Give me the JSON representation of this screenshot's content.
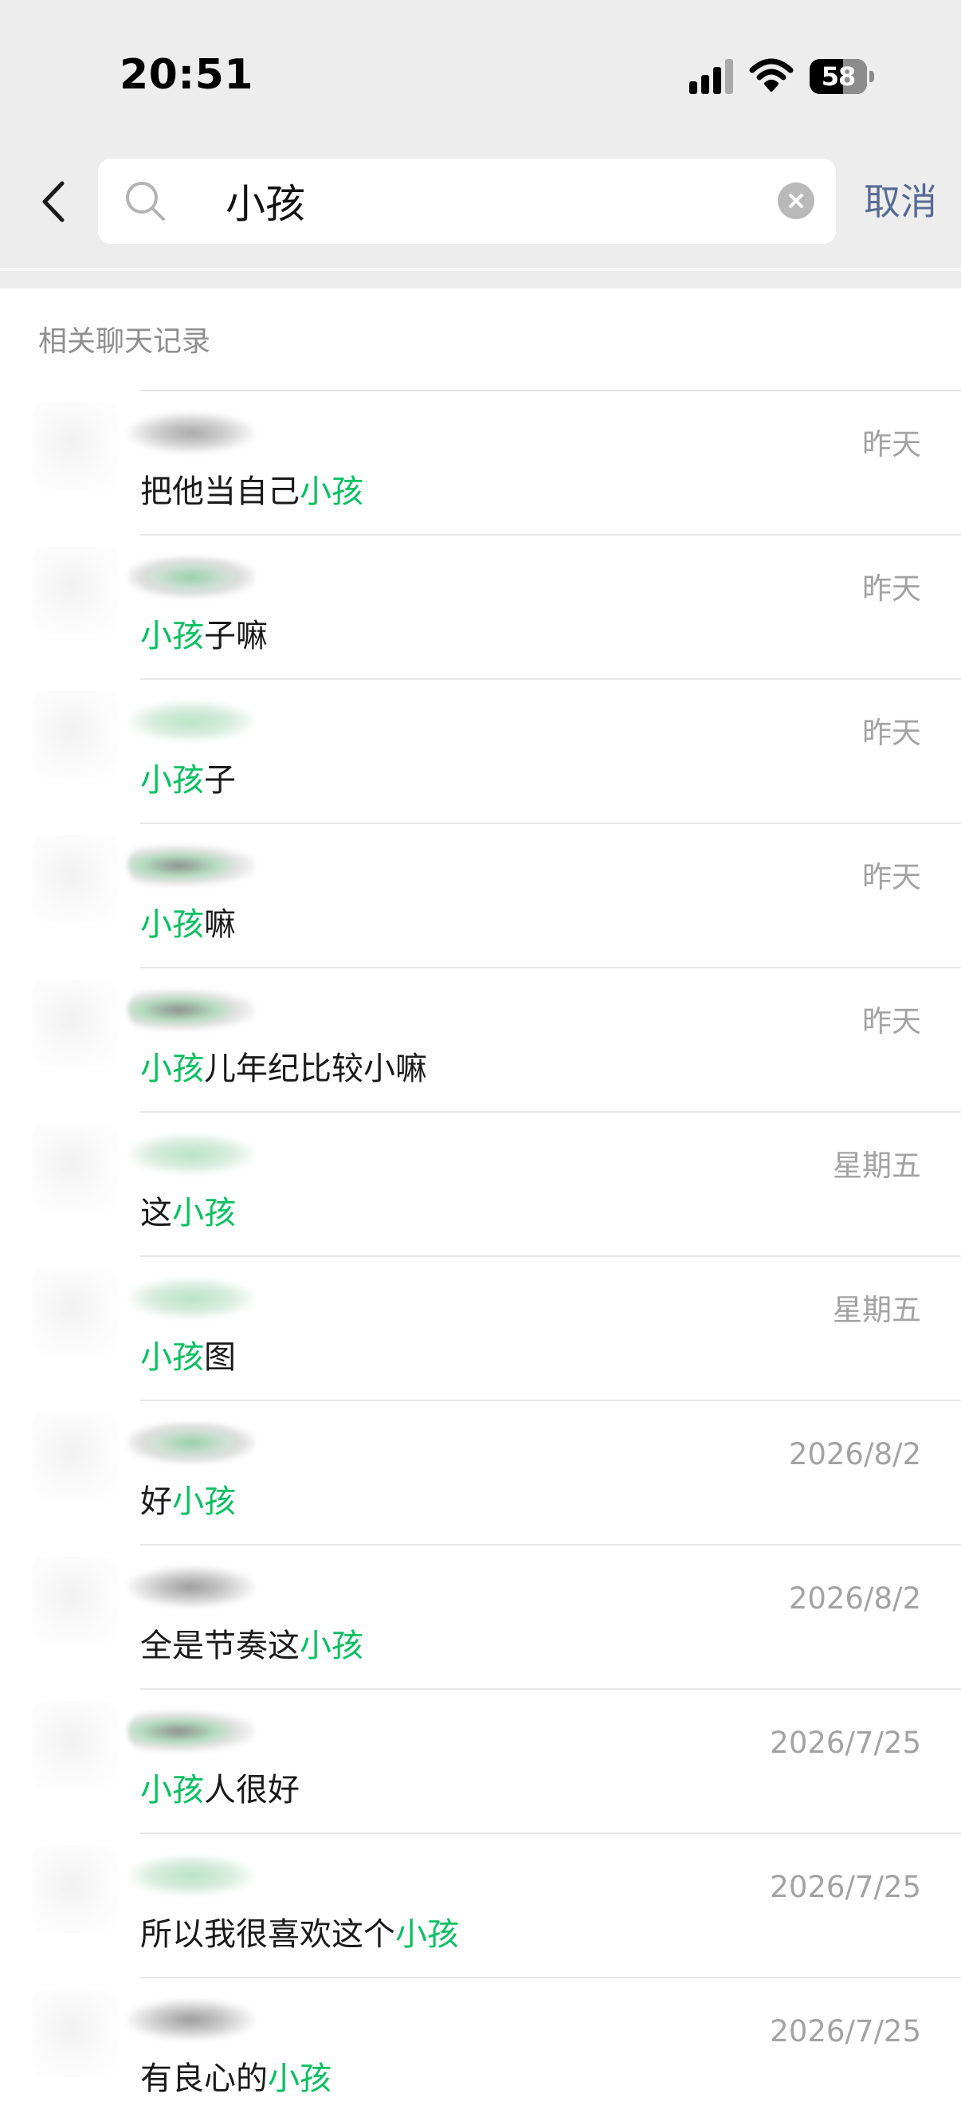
{
  "status_bar": {
    "time": "20:51",
    "battery_level": "58",
    "battery_fraction": 0.58,
    "signal_bars_filled": 3,
    "signal_bars_total": 4
  },
  "search": {
    "query": "小孩",
    "cancel_label": "取消",
    "clear_icon": "clear-icon",
    "search_icon": "search-icon",
    "back_icon": "back-chevron-icon"
  },
  "section": {
    "title": "相关聊天记录"
  },
  "colors": {
    "highlight": "#07c160",
    "link": "#576b95",
    "background_grey": "#ededed"
  },
  "results": [
    {
      "date": "昨天",
      "pre": "把他当自己",
      "hit": "小孩",
      "post": ""
    },
    {
      "date": "昨天",
      "pre": "",
      "hit": "小孩",
      "post": "子嘛"
    },
    {
      "date": "昨天",
      "pre": "",
      "hit": "小孩",
      "post": "子"
    },
    {
      "date": "昨天",
      "pre": "",
      "hit": "小孩",
      "post": "嘛"
    },
    {
      "date": "昨天",
      "pre": "",
      "hit": "小孩",
      "post": "儿年纪比较小嘛"
    },
    {
      "date": "星期五",
      "pre": "这",
      "hit": "小孩",
      "post": ""
    },
    {
      "date": "星期五",
      "pre": "",
      "hit": "小孩",
      "post": "图"
    },
    {
      "date": "2026/8/2",
      "pre": "好",
      "hit": "小孩",
      "post": ""
    },
    {
      "date": "2026/8/2",
      "pre": "全是节奏这",
      "hit": "小孩",
      "post": ""
    },
    {
      "date": "2026/7/25",
      "pre": "",
      "hit": "小孩",
      "post": "人很好"
    },
    {
      "date": "2026/7/25",
      "pre": "所以我很喜欢这个",
      "hit": "小孩",
      "post": ""
    },
    {
      "date": "2026/7/25",
      "pre": "有良心的",
      "hit": "小孩",
      "post": ""
    }
  ]
}
